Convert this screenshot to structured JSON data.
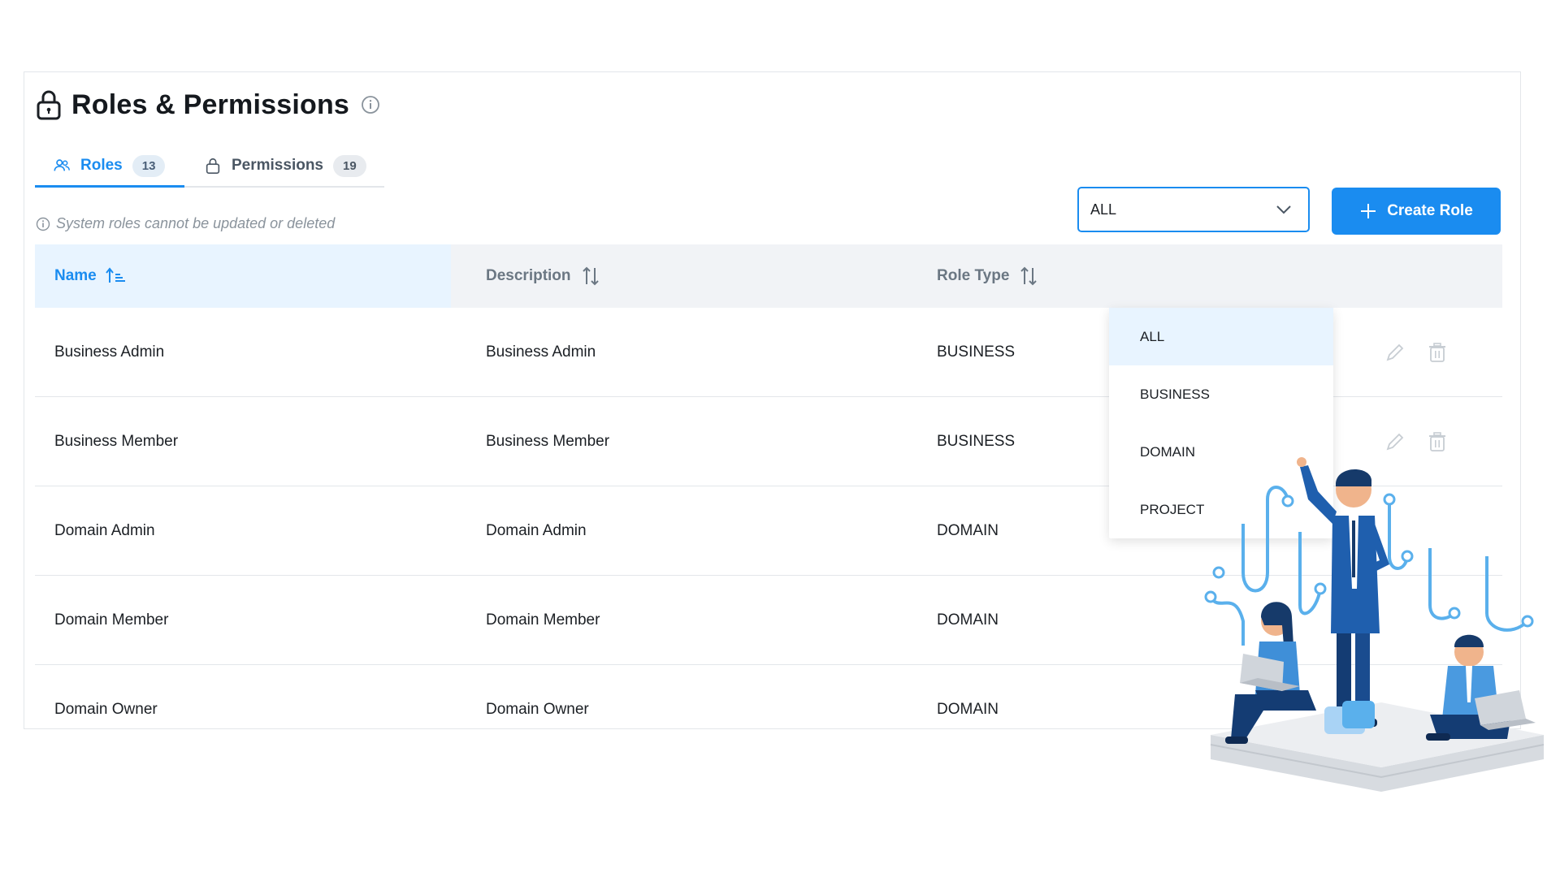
{
  "page": {
    "title": "Roles & Permissions",
    "note": "System roles cannot be updated or deleted"
  },
  "tabs": [
    {
      "label": "Roles",
      "count": "13",
      "active": true
    },
    {
      "label": "Permissions",
      "count": "19",
      "active": false
    }
  ],
  "filter": {
    "selected": "ALL",
    "options": [
      "ALL",
      "BUSINESS",
      "DOMAIN",
      "PROJECT"
    ]
  },
  "create_button": {
    "label": "Create Role"
  },
  "table": {
    "columns": [
      "Name",
      "Description",
      "Role Type"
    ],
    "rows": [
      {
        "name": "Business Admin",
        "description": "Business Admin",
        "type": "BUSINESS"
      },
      {
        "name": "Business Member",
        "description": "Business Member",
        "type": "BUSINESS"
      },
      {
        "name": "Domain Admin",
        "description": "Domain Admin",
        "type": "DOMAIN"
      },
      {
        "name": "Domain Member",
        "description": "Domain Member",
        "type": "DOMAIN"
      },
      {
        "name": "Domain Owner",
        "description": "Domain Owner",
        "type": "DOMAIN"
      }
    ]
  },
  "icons": {
    "title": "lock-icon",
    "info": "info-icon",
    "roles_tab": "users-icon",
    "permissions_tab": "lock-icon",
    "sort_active": "sort-ascending-icon",
    "sort": "sort-icon",
    "dropdown": "chevron-down-icon",
    "create": "plus-icon",
    "row_edit": "edit-icon",
    "row_delete": "trash-icon"
  },
  "colors": {
    "accent": "#1a8cf0",
    "header_bg": "#f1f3f6",
    "active_header_bg": "#e8f4ff",
    "muted_text": "#8a939c"
  }
}
